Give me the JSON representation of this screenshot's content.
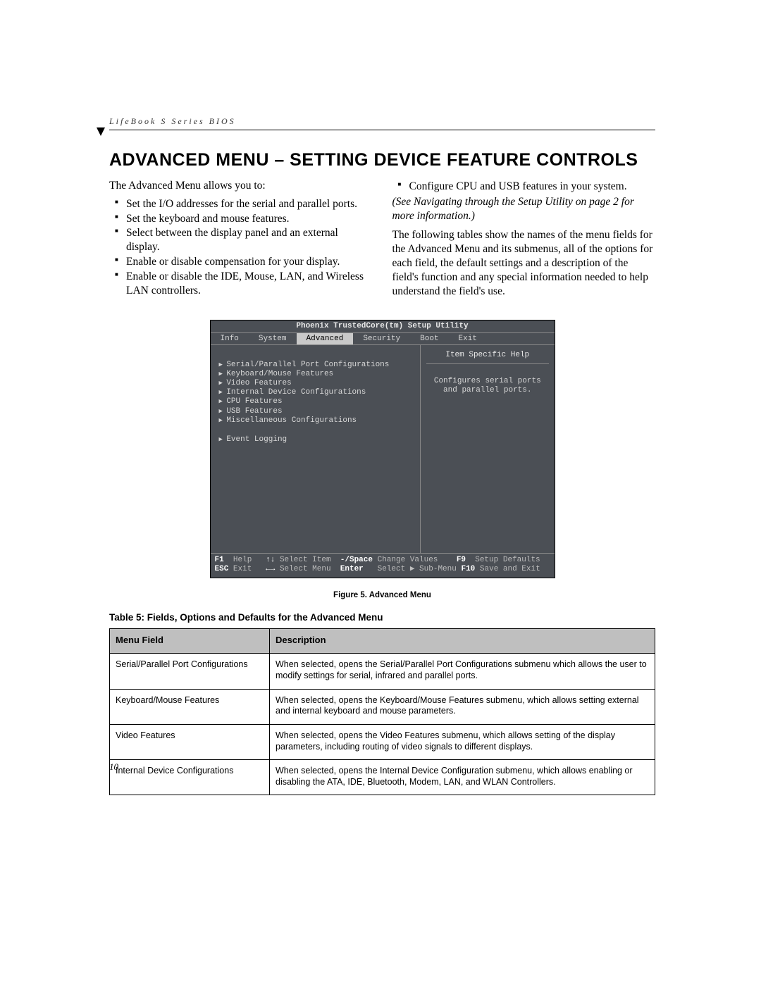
{
  "running_head": "LifeBook S Series BIOS",
  "heading": "ADVANCED MENU – SETTING DEVICE FEATURE CONTROLS",
  "left_col": {
    "intro": "The Advanced Menu allows you to:",
    "bullets": [
      "Set the I/O addresses for the serial and parallel ports.",
      "Set the keyboard and mouse features.",
      "Select between the display panel and an external display.",
      "Enable or disable compensation for your display.",
      "Enable or disable the IDE, Mouse, LAN, and Wireless LAN controllers."
    ]
  },
  "right_col": {
    "bullet": "Configure CPU and USB features in your system.",
    "italic": "(See Navigating through the Setup Utility on page 2 for more information.)",
    "para": "The following tables show the names of the menu fields for the Advanced Menu and its submenus, all of the options for each field, the default settings and a description of the field's function and any special information needed to help understand the field's use."
  },
  "bios": {
    "title": "Phoenix TrustedCore(tm) Setup Utility",
    "tabs": [
      "Info",
      "System",
      "Advanced",
      "Security",
      "Boot",
      "Exit"
    ],
    "active_tab": "Advanced",
    "items": [
      "Serial/Parallel Port Configurations",
      "Keyboard/Mouse Features",
      "Video Features",
      "Internal Device Configurations",
      "CPU Features",
      "USB Features",
      "Miscellaneous Configurations"
    ],
    "extra_item": "Event Logging",
    "help_title": "Item Specific Help",
    "help_text": "Configures serial ports and parallel ports.",
    "footer": {
      "r1": {
        "k1": "F1",
        "t1": "Help",
        "k2": "↑↓",
        "t2": "Select Item",
        "k3": "-/Space",
        "t3": "Change Values",
        "k4": "F9",
        "t4": "Setup Defaults"
      },
      "r2": {
        "k1": "ESC",
        "t1": "Exit",
        "k2": "←→",
        "t2": "Select Menu",
        "k3": "Enter",
        "t3": "Select ▶ Sub-Menu",
        "k4": "F10",
        "t4": "Save and Exit"
      }
    }
  },
  "figure_caption": "Figure 5.  Advanced Menu",
  "table_caption": "Table 5: Fields, Options and Defaults for the Advanced Menu",
  "table": {
    "headers": [
      "Menu Field",
      "Description"
    ],
    "rows": [
      [
        "Serial/Parallel Port Configurations",
        "When selected, opens the Serial/Parallel Port Configurations submenu which allows the user to modify settings for serial, infrared and parallel ports."
      ],
      [
        "Keyboard/Mouse Features",
        "When selected, opens the Keyboard/Mouse Features submenu, which allows setting external and internal keyboard and mouse parameters."
      ],
      [
        "Video Features",
        "When selected, opens the Video Features submenu, which allows setting of the display parameters, including routing of video signals to different displays."
      ],
      [
        "Internal Device Configurations",
        "When selected, opens the Internal Device Configuration submenu, which allows enabling or disabling the ATA, IDE, Bluetooth, Modem, LAN, and WLAN Controllers."
      ]
    ]
  },
  "page_number": "10"
}
